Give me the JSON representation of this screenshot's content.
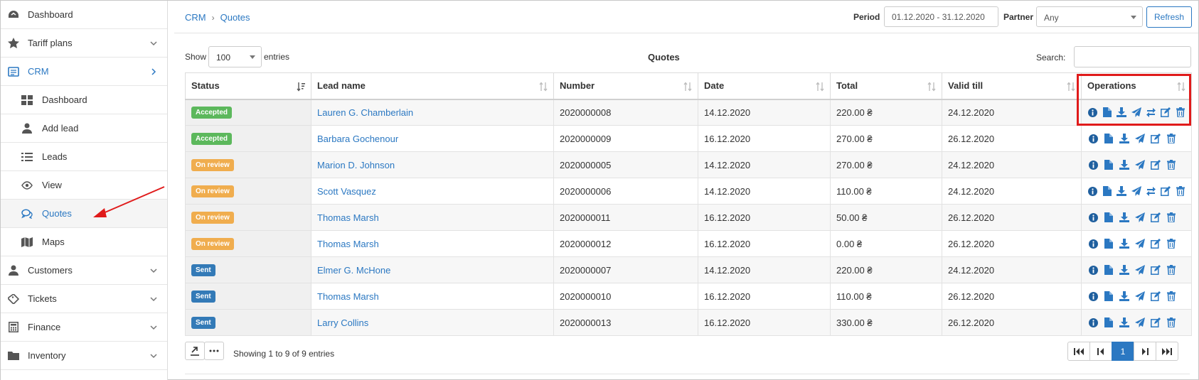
{
  "sidebar": {
    "items": [
      {
        "label": "Dashboard",
        "icon": "dashboard-icon"
      },
      {
        "label": "Tariff plans",
        "icon": "star-icon"
      },
      {
        "label": "CRM",
        "icon": "crm-icon"
      },
      {
        "label": "Dashboard",
        "icon": "grid-icon"
      },
      {
        "label": "Add lead",
        "icon": "user-icon"
      },
      {
        "label": "Leads",
        "icon": "list-icon"
      },
      {
        "label": "View",
        "icon": "eye-icon"
      },
      {
        "label": "Quotes",
        "icon": "comments-icon"
      },
      {
        "label": "Maps",
        "icon": "map-icon"
      },
      {
        "label": "Customers",
        "icon": "user-icon"
      },
      {
        "label": "Tickets",
        "icon": "ticket-icon"
      },
      {
        "label": "Finance",
        "icon": "calculator-icon"
      },
      {
        "label": "Inventory",
        "icon": "folder-icon"
      }
    ]
  },
  "breadcrumb": {
    "root": "CRM",
    "current": "Quotes"
  },
  "filters": {
    "period_label": "Period",
    "period_value": "01.12.2020 - 31.12.2020",
    "partner_label": "Partner",
    "partner_value": "Any",
    "refresh_label": "Refresh"
  },
  "controls": {
    "show_label": "Show",
    "show_value": "100",
    "entries_label": "entries",
    "title": "Quotes",
    "search_label": "Search:"
  },
  "table": {
    "columns": [
      "Status",
      "Lead name",
      "Number",
      "Date",
      "Total",
      "Valid till",
      "Operations"
    ],
    "rows": [
      {
        "status": "Accepted",
        "kind": "accepted",
        "lead": "Lauren G. Chamberlain",
        "number": "2020000008",
        "date": "14.12.2020",
        "total": "220.00 ₴",
        "valid": "24.12.2020",
        "convert": true
      },
      {
        "status": "Accepted",
        "kind": "accepted",
        "lead": "Barbara Gochenour",
        "number": "2020000009",
        "date": "16.12.2020",
        "total": "270.00 ₴",
        "valid": "26.12.2020",
        "convert": false
      },
      {
        "status": "On review",
        "kind": "review",
        "lead": "Marion D. Johnson",
        "number": "2020000005",
        "date": "14.12.2020",
        "total": "270.00 ₴",
        "valid": "24.12.2020",
        "convert": false
      },
      {
        "status": "On review",
        "kind": "review",
        "lead": "Scott Vasquez",
        "number": "2020000006",
        "date": "14.12.2020",
        "total": "110.00 ₴",
        "valid": "24.12.2020",
        "convert": true
      },
      {
        "status": "On review",
        "kind": "review",
        "lead": "Thomas Marsh",
        "number": "2020000011",
        "date": "16.12.2020",
        "total": "50.00 ₴",
        "valid": "26.12.2020",
        "convert": false
      },
      {
        "status": "On review",
        "kind": "review",
        "lead": "Thomas Marsh",
        "number": "2020000012",
        "date": "16.12.2020",
        "total": "0.00 ₴",
        "valid": "26.12.2020",
        "convert": false
      },
      {
        "status": "Sent",
        "kind": "sent",
        "lead": "Elmer G. McHone",
        "number": "2020000007",
        "date": "14.12.2020",
        "total": "220.00 ₴",
        "valid": "24.12.2020",
        "convert": false
      },
      {
        "status": "Sent",
        "kind": "sent",
        "lead": "Thomas Marsh",
        "number": "2020000010",
        "date": "16.12.2020",
        "total": "110.00 ₴",
        "valid": "26.12.2020",
        "convert": false
      },
      {
        "status": "Sent",
        "kind": "sent",
        "lead": "Larry Collins",
        "number": "2020000013",
        "date": "16.12.2020",
        "total": "330.00 ₴",
        "valid": "26.12.2020",
        "convert": false
      }
    ]
  },
  "footer": {
    "showing": "Showing 1 to 9 of 9 entries",
    "current_page": "1"
  },
  "colors": {
    "accent": "#2b78c2",
    "accepted": "#5cb85c",
    "review": "#f0ad4e",
    "sent": "#337ab7",
    "highlight": "#e01b1b"
  }
}
